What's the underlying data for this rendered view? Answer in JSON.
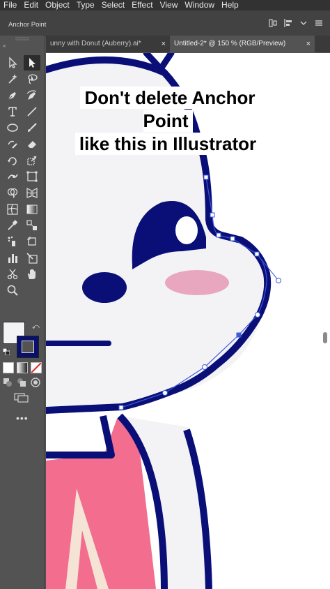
{
  "menu": [
    "File",
    "Edit",
    "Object",
    "Type",
    "Select",
    "Effect",
    "View",
    "Window",
    "Help"
  ],
  "control_bar": {
    "selection_label": "Anchor Point"
  },
  "tabs": [
    {
      "label": "unny with Donut (Auberry).ai*",
      "close": "×",
      "active": false
    },
    {
      "label": "Untitled-2* @ 150 % (RGB/Preview)",
      "close": "×",
      "active": true
    }
  ],
  "tools": [
    "selection-tool",
    "direct-selection-tool",
    "magic-wand-tool",
    "lasso-tool",
    "pen-tool",
    "curvature-tool",
    "type-tool",
    "line-segment-tool",
    "ellipse-tool",
    "paintbrush-tool",
    "shaper-tool",
    "eraser-tool",
    "rotate-tool",
    "scale-tool",
    "puppet-warp-tool",
    "free-transform-tool",
    "shape-builder-tool",
    "perspective-grid-tool",
    "mesh-tool",
    "gradient-tool",
    "eyedropper-tool",
    "blend-tool",
    "symbol-sprayer-tool",
    "artboard-tool",
    "column-graph-tool",
    "slice-tool",
    "scissors-tool",
    "hand-tool",
    "zoom-tool"
  ],
  "selected_tool": "direct-selection-tool",
  "colors": {
    "fill": "#f3f3f5",
    "stroke": "#08106b",
    "outline": "#0a0f78",
    "blush": "#e9a6bf",
    "shirt": "#f26d8e",
    "selection": "#3b5bdb"
  },
  "caption": {
    "line1": "Don't delete Anchor Point",
    "line2": "like this in Illustrator"
  },
  "more_tools": "•••"
}
